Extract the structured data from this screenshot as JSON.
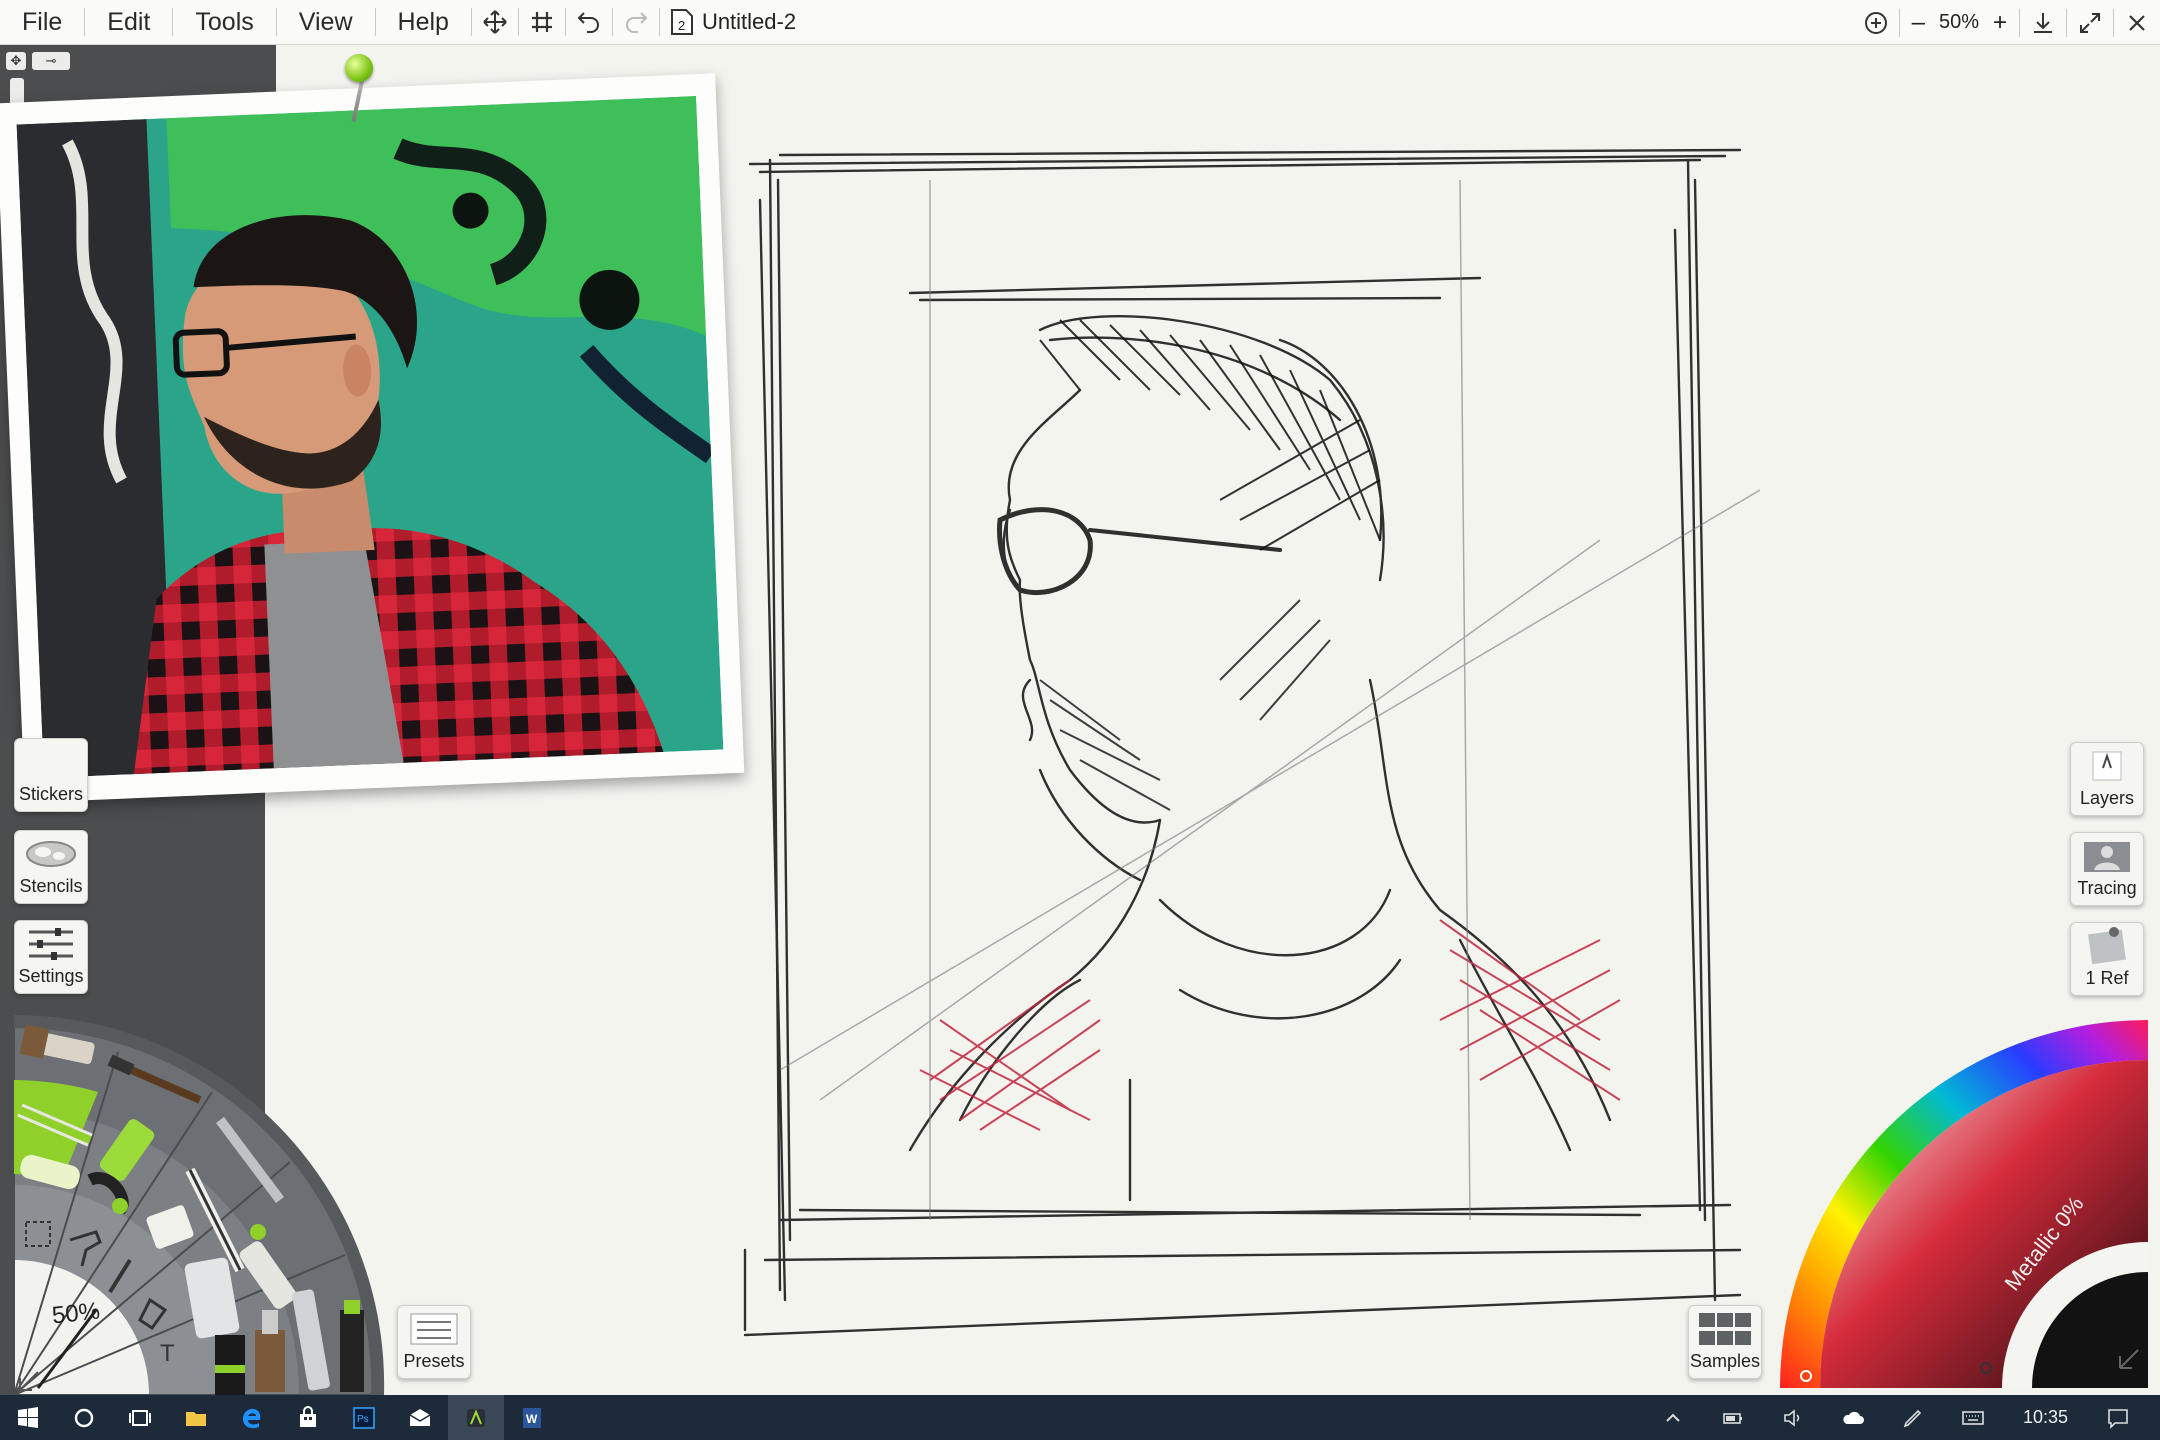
{
  "menu": {
    "items": [
      "File",
      "Edit",
      "Tools",
      "View",
      "Help"
    ]
  },
  "toolbar": {
    "doc_number": "2",
    "doc_title": "Untitled-2",
    "zoom_minus": "–",
    "zoom_level": "50%",
    "zoom_plus": "+"
  },
  "left_panel": {
    "stickers_label": "Stickers",
    "stencils_label": "Stencils",
    "settings_label": "Settings",
    "presets_label": "Presets",
    "tool_zoom": "50%",
    "text_tool_label": "T"
  },
  "right_panel": {
    "layers_label": "Layers",
    "tracing_label": "Tracing",
    "ref_label": "1 Ref",
    "samples_label": "Samples",
    "metallic_label": "Metallic 0%"
  },
  "taskbar": {
    "clock": "10:35",
    "ps_label": "Ps",
    "word_label": "W"
  },
  "colors": {
    "menubar_bg": "#fbfbf9",
    "panel_dark": "#4b4d4f",
    "canvas_bg": "#f4f4ef",
    "taskbar_bg": "#1d2a3a",
    "accent_green": "#8fd12a"
  }
}
